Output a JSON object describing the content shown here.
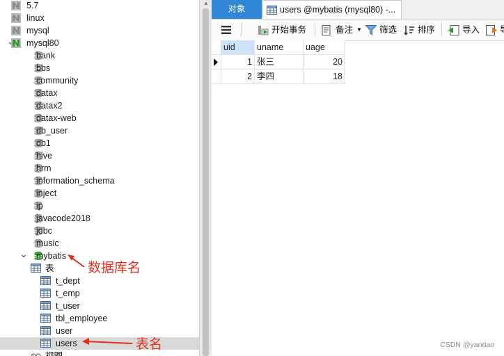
{
  "tree": {
    "items": [
      {
        "label": "5.7",
        "type": "connection",
        "state": "closed",
        "indent": 0,
        "arrow": ""
      },
      {
        "label": "linux",
        "type": "connection",
        "state": "closed",
        "indent": 0,
        "arrow": ""
      },
      {
        "label": "mysql",
        "type": "connection",
        "state": "closed",
        "indent": 0,
        "arrow": ""
      },
      {
        "label": "mysql80",
        "type": "connection",
        "state": "open",
        "indent": 0,
        "arrow": "expanded"
      },
      {
        "label": "bank",
        "type": "database",
        "state": "closed",
        "indent": 1,
        "arrow": ""
      },
      {
        "label": "bbs",
        "type": "database",
        "state": "closed",
        "indent": 1,
        "arrow": ""
      },
      {
        "label": "community",
        "type": "database",
        "state": "closed",
        "indent": 1,
        "arrow": ""
      },
      {
        "label": "datax",
        "type": "database",
        "state": "closed",
        "indent": 1,
        "arrow": ""
      },
      {
        "label": "datax2",
        "type": "database",
        "state": "closed",
        "indent": 1,
        "arrow": ""
      },
      {
        "label": "datax-web",
        "type": "database",
        "state": "closed",
        "indent": 1,
        "arrow": ""
      },
      {
        "label": "db_user",
        "type": "database",
        "state": "closed",
        "indent": 1,
        "arrow": ""
      },
      {
        "label": "db1",
        "type": "database",
        "state": "closed",
        "indent": 1,
        "arrow": ""
      },
      {
        "label": "hive",
        "type": "database",
        "state": "closed",
        "indent": 1,
        "arrow": ""
      },
      {
        "label": "hrm",
        "type": "database",
        "state": "closed",
        "indent": 1,
        "arrow": ""
      },
      {
        "label": "information_schema",
        "type": "database",
        "state": "closed",
        "indent": 1,
        "arrow": ""
      },
      {
        "label": "inject",
        "type": "database",
        "state": "closed",
        "indent": 1,
        "arrow": ""
      },
      {
        "label": "ip",
        "type": "database",
        "state": "closed",
        "indent": 1,
        "arrow": ""
      },
      {
        "label": "javacode2018",
        "type": "database",
        "state": "closed",
        "indent": 1,
        "arrow": ""
      },
      {
        "label": "jdbc",
        "type": "database",
        "state": "closed",
        "indent": 1,
        "arrow": ""
      },
      {
        "label": "music",
        "type": "database",
        "state": "closed",
        "indent": 1,
        "arrow": ""
      },
      {
        "label": "mybatis",
        "type": "database",
        "state": "open",
        "indent": 1,
        "arrow": "expanded"
      },
      {
        "label": "表",
        "type": "folder",
        "state": "open",
        "indent": 2,
        "arrow": "expanded"
      },
      {
        "label": "t_dept",
        "type": "table",
        "state": "",
        "indent": 3,
        "arrow": ""
      },
      {
        "label": "t_emp",
        "type": "table",
        "state": "",
        "indent": 3,
        "arrow": ""
      },
      {
        "label": "t_user",
        "type": "table",
        "state": "",
        "indent": 3,
        "arrow": ""
      },
      {
        "label": "tbl_employee",
        "type": "table",
        "state": "",
        "indent": 3,
        "arrow": ""
      },
      {
        "label": "user",
        "type": "table",
        "state": "",
        "indent": 3,
        "arrow": ""
      },
      {
        "label": "users",
        "type": "table",
        "state": "selected",
        "indent": 3,
        "arrow": ""
      },
      {
        "label": "视图",
        "type": "view",
        "state": "",
        "indent": 2,
        "arrow": "collapsed"
      }
    ]
  },
  "tabs": {
    "objects_label": "对象",
    "active_label": "users @mybatis (mysql80) -..."
  },
  "toolbar": {
    "menu_icon": "hamburger-icon",
    "begin_tx": "开始事务",
    "note": "备注",
    "filter": "筛选",
    "sort": "排序",
    "import": "导入",
    "export": "导"
  },
  "grid": {
    "columns": [
      "uid",
      "uname",
      "uage"
    ],
    "rows": [
      {
        "uid": "1",
        "uname": "张三",
        "uage": "20",
        "current": true
      },
      {
        "uid": "2",
        "uname": "李四",
        "uage": "18",
        "current": false
      }
    ]
  },
  "annotations": {
    "db_name": "数据库名",
    "table_name": "表名"
  },
  "watermark": "CSDN @yandao",
  "colors": {
    "accent": "#2f86d7",
    "connection_open": "#2e9a2e",
    "database": "#9e9e9e",
    "database_open": "#3aa63a",
    "annotation": "#e03020"
  }
}
